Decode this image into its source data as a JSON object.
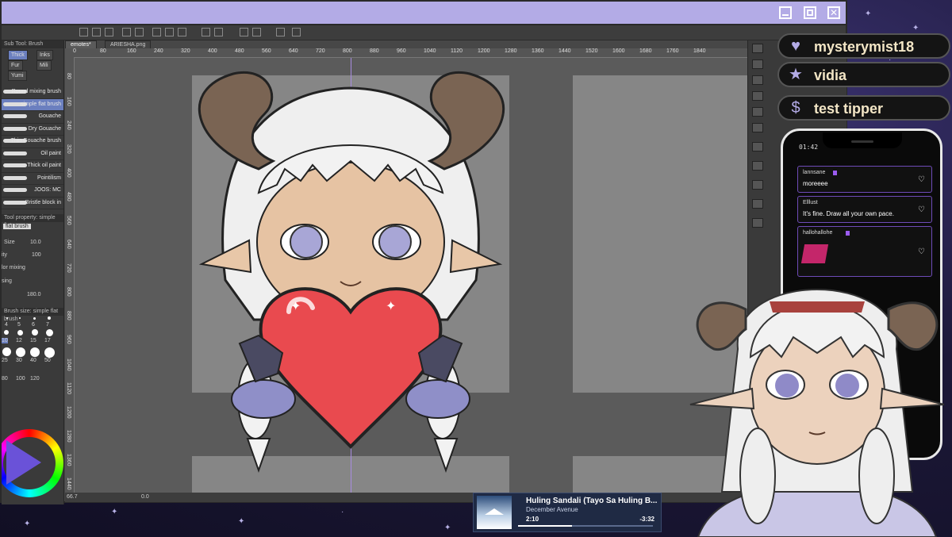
{
  "window": {
    "minimize_icon": "minimize-icon",
    "maximize_icon": "maximize-icon",
    "close_icon": "close-icon"
  },
  "left_panel": {
    "title": "Sub Tool: Brush",
    "sub_tabs": [
      "Thick",
      "Inks",
      "Fur",
      "Mili",
      "Yumi"
    ],
    "brushes": [
      "Round mixing brush",
      "simple flat brush",
      "Gouache",
      "Dry Gouache",
      "Thin Gouache brush",
      "Oil paint",
      "Thick oil paint",
      "Pointilism",
      "JOOS: MC",
      "Bristle block in"
    ],
    "tool_property_title": "Tool property: simple flat",
    "tool_property_name": "flat brush",
    "size_label": "Size",
    "size_value": "10.0",
    "density_label": "ity",
    "density_value": "100",
    "color_mixing_label": "lor mixing",
    "blending_label": "sing",
    "angle_value": "180.0",
    "brush_size_title": "Brush size: simple flat brush",
    "brush_size_values": [
      "4",
      "5",
      "6",
      "7",
      "10",
      "12",
      "15",
      "17",
      "25",
      "30",
      "40",
      "50",
      "80",
      "100",
      "120"
    ]
  },
  "doc_tabs": [
    "emotes*",
    "ARIESHA.png"
  ],
  "ruler": {
    "top_ticks": [
      "0",
      "80",
      "160",
      "240",
      "320",
      "400",
      "480",
      "560",
      "640",
      "720",
      "800",
      "880",
      "960",
      "1040",
      "1120",
      "1200",
      "1280",
      "1360",
      "1440",
      "1520",
      "1600",
      "1680",
      "1760",
      "1840"
    ],
    "left_ticks": [
      "80",
      "160",
      "240",
      "320",
      "400",
      "480",
      "560",
      "640",
      "720",
      "800",
      "880",
      "960",
      "1040",
      "1120",
      "1200",
      "1280",
      "1360",
      "1440"
    ]
  },
  "status": {
    "zoom": "66.7",
    "angle": "0.0"
  },
  "alerts": [
    {
      "icon": "heart-icon",
      "glyph": "♥",
      "name": "mysterymist18"
    },
    {
      "icon": "star-icon",
      "glyph": "★",
      "name": "vidia"
    },
    {
      "icon": "dollar-icon",
      "glyph": "$",
      "name": "test tipper"
    }
  ],
  "phone": {
    "time": "01:42",
    "messages": [
      {
        "user": "lannsane",
        "text": "moreeee"
      },
      {
        "user": "Elllust",
        "text": "It's fine. Draw all your own pace."
      },
      {
        "user": "hallohallohe",
        "text": ""
      }
    ]
  },
  "music": {
    "title": "Huling Sandali (Tayo Sa Huling B...",
    "artist": "December Avenue",
    "elapsed": "2:10",
    "remaining": "-3:32",
    "progress": 0.4
  },
  "colors": {
    "titlebar": "#b3abe6",
    "accent": "#6e4bb8",
    "heart": "#e94a4f"
  }
}
